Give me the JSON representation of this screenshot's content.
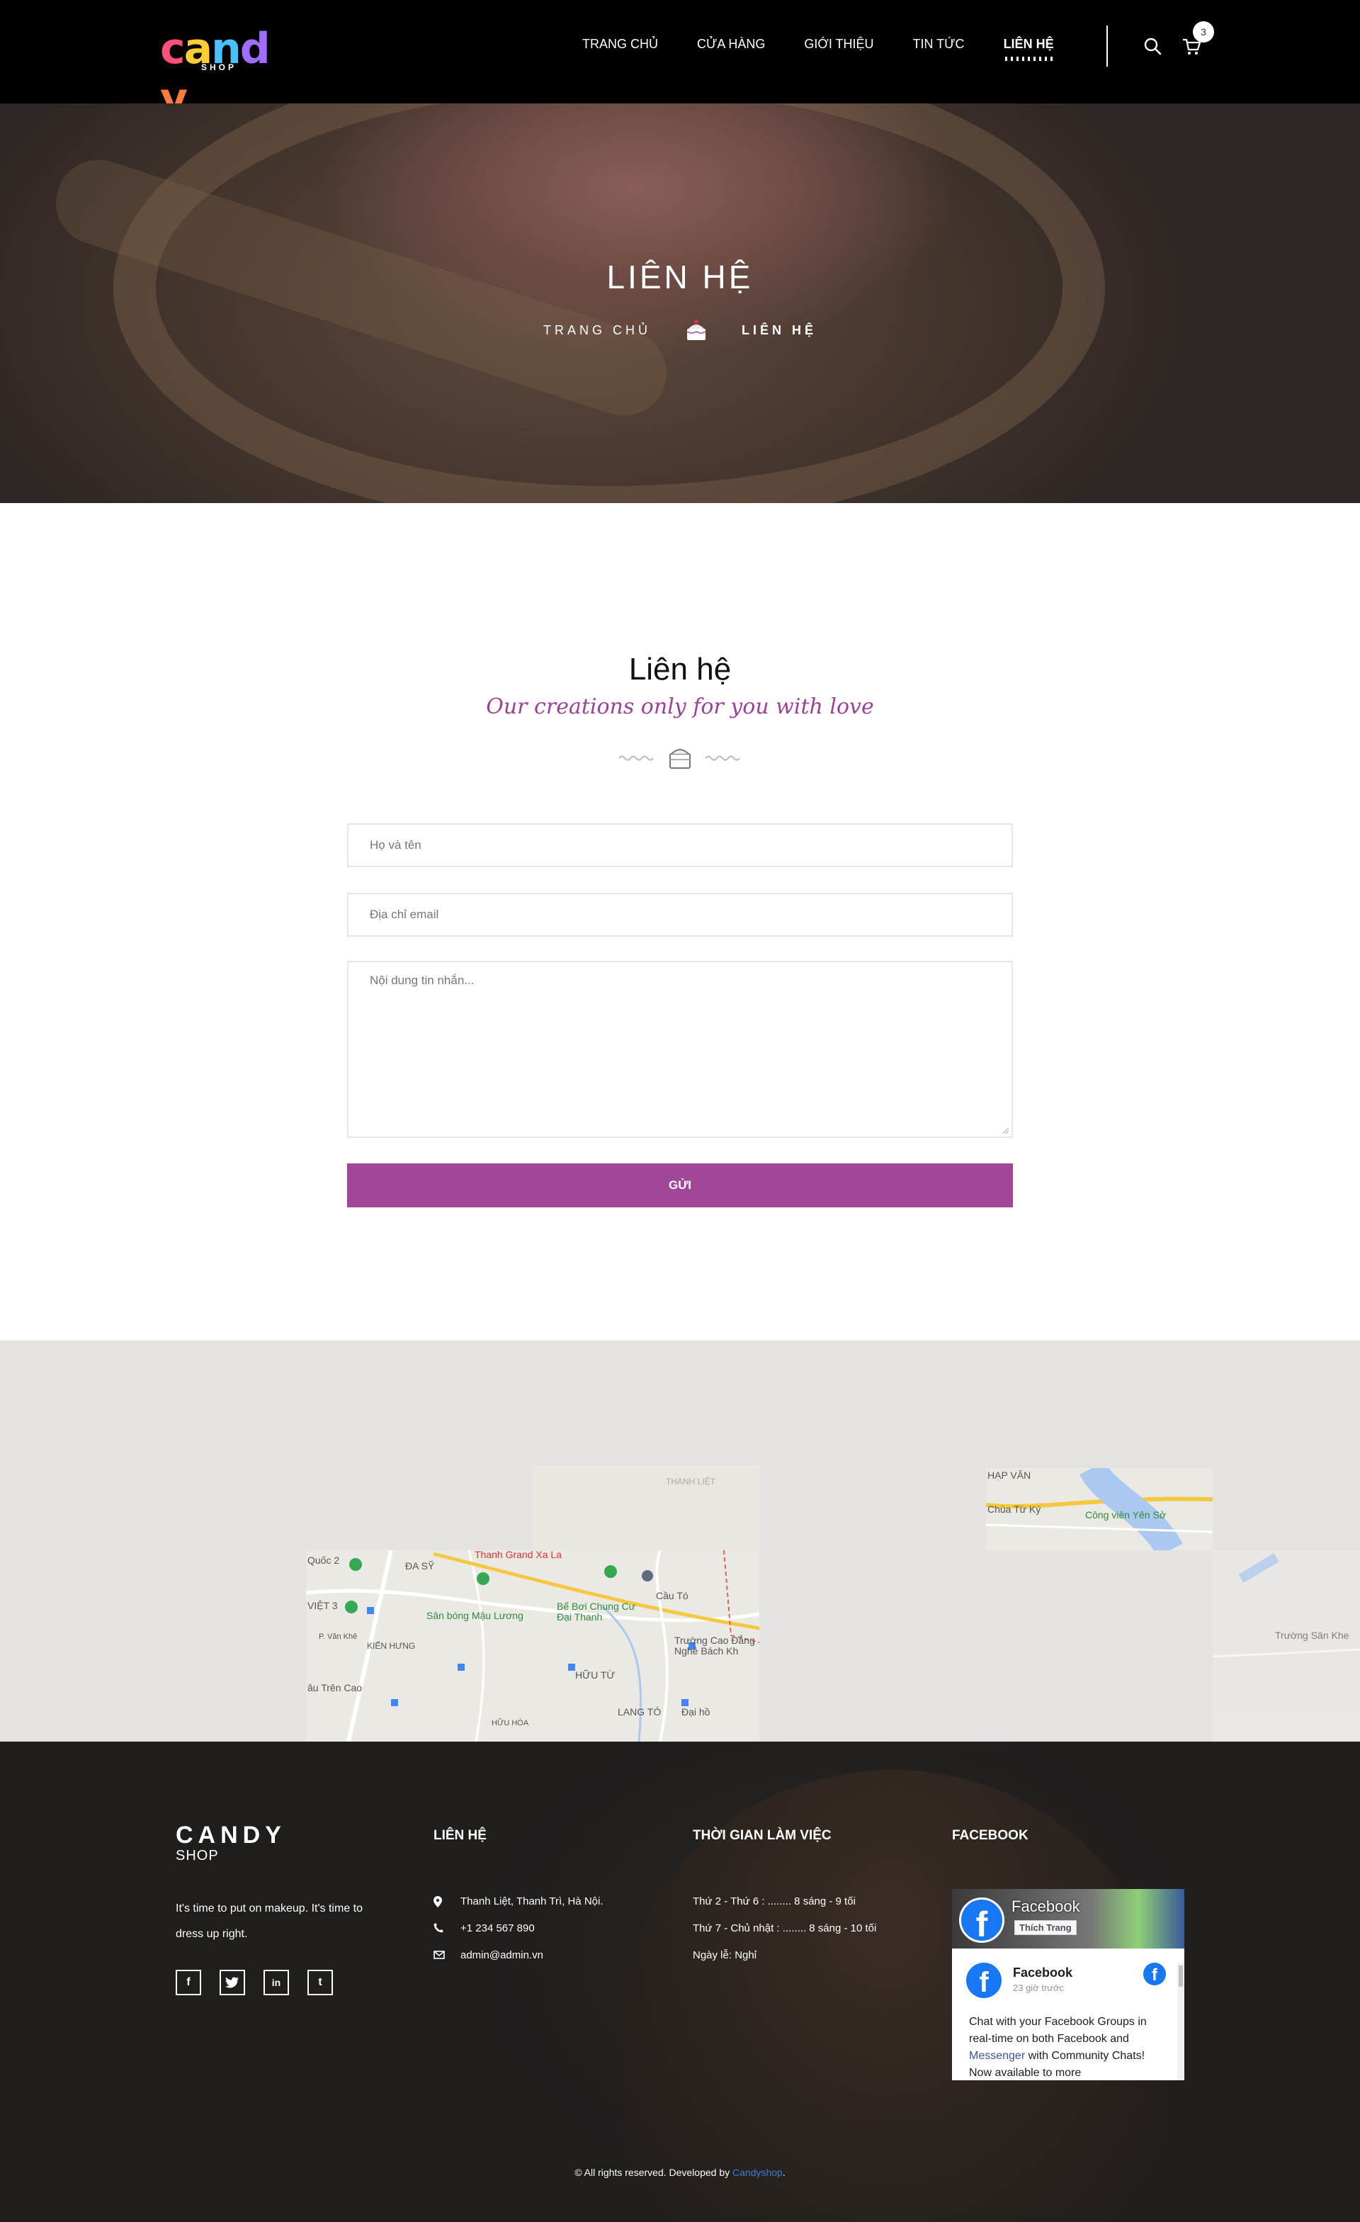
{
  "header": {
    "logo_text": "candy",
    "logo_sub": "SHOP",
    "nav": [
      {
        "label": "TRANG CHỦ"
      },
      {
        "label": "CỬA HÀNG"
      },
      {
        "label": "GIỚI THIỆU"
      },
      {
        "label": "TIN TỨC"
      },
      {
        "label": "LIÊN HỆ",
        "active": true
      }
    ],
    "cart_count": "3",
    "icons": {
      "search": "search-icon",
      "cart": "cart-icon"
    }
  },
  "hero": {
    "title": "LIÊN HỆ",
    "breadcrumb_home": "TRANG CHỦ",
    "breadcrumb_current": "LIÊN HỆ"
  },
  "contact": {
    "title": "Liên hệ",
    "subtitle": "Our creations only for you with love",
    "name_placeholder": "Họ và tên",
    "email_placeholder": "Địa chỉ email",
    "message_placeholder": "Nội dung tin nhắn...",
    "submit_label": "GỬI",
    "accent_color": "#a14799"
  },
  "map": {
    "labels": {
      "l1": "Quốc 2",
      "l2": "ĐA SỸ",
      "l3": "Thanh Grand Xa La",
      "l4": "VIỆT 3",
      "l5": "Sân bóng Mậu Lương",
      "l6": "Bể Bơi Chung Cư Đại Thanh",
      "l7": "Cầu Tó",
      "l8": "KIẾN HƯNG",
      "l9": "Trường Cao Đẳng Nghề Bách Kh",
      "l10": "âu Trên Cao",
      "l11": "HỮU TỪ",
      "l12": "LANG TÓ",
      "l13": "HỮU HÒA",
      "l14": "Đại hồ",
      "l15": "HẠP VĂN",
      "l16": "Chùa Từ Ký",
      "l17": "Công viên Yên Sở",
      "l18": "THANH LIỆT",
      "l19": "P. Văn Khê",
      "l20": "Trường Sân Khe"
    }
  },
  "footer": {
    "logo_main": "CANDY",
    "logo_sub": "SHOP",
    "about": "It's time to put on makeup. It's time to dress up right.",
    "social": [
      {
        "name": "facebook",
        "glyph": "f"
      },
      {
        "name": "twitter",
        "glyph": "t"
      },
      {
        "name": "linkedin",
        "glyph": "in"
      },
      {
        "name": "tumblr",
        "glyph": "t"
      }
    ],
    "contact_title": "LIÊN HỆ",
    "address": "Thanh Liệt, Thanh Trì, Hà Nội.",
    "phone": "+1 234 567 890",
    "email": "admin@admin.vn",
    "hours_title": "THỜI GIAN LÀM VIỆC",
    "hours_1": "Thứ 2 - Thứ 6 : ........ 8 sáng - 9 tối",
    "hours_2": "Thứ 7 - Chủ nhật : ........ 8 sáng - 10 tối",
    "hours_3": "Ngày lễ: Nghỉ",
    "facebook_title": "FACEBOOK",
    "fb_page_name": "Facebook",
    "fb_like": "Thích Trang",
    "fb_post_name": "Facebook",
    "fb_post_time": "23 giờ trước",
    "fb_post_text_1": "Chat with your Facebook Groups in real-time on both Facebook and ",
    "fb_post_link": "Messenger",
    "fb_post_text_2": " with Community Chats! Now available to more",
    "copyright_prefix": "© All rights reserved. Developed by ",
    "copyright_brand": "Candyshop",
    "copyright_suffix": "."
  }
}
